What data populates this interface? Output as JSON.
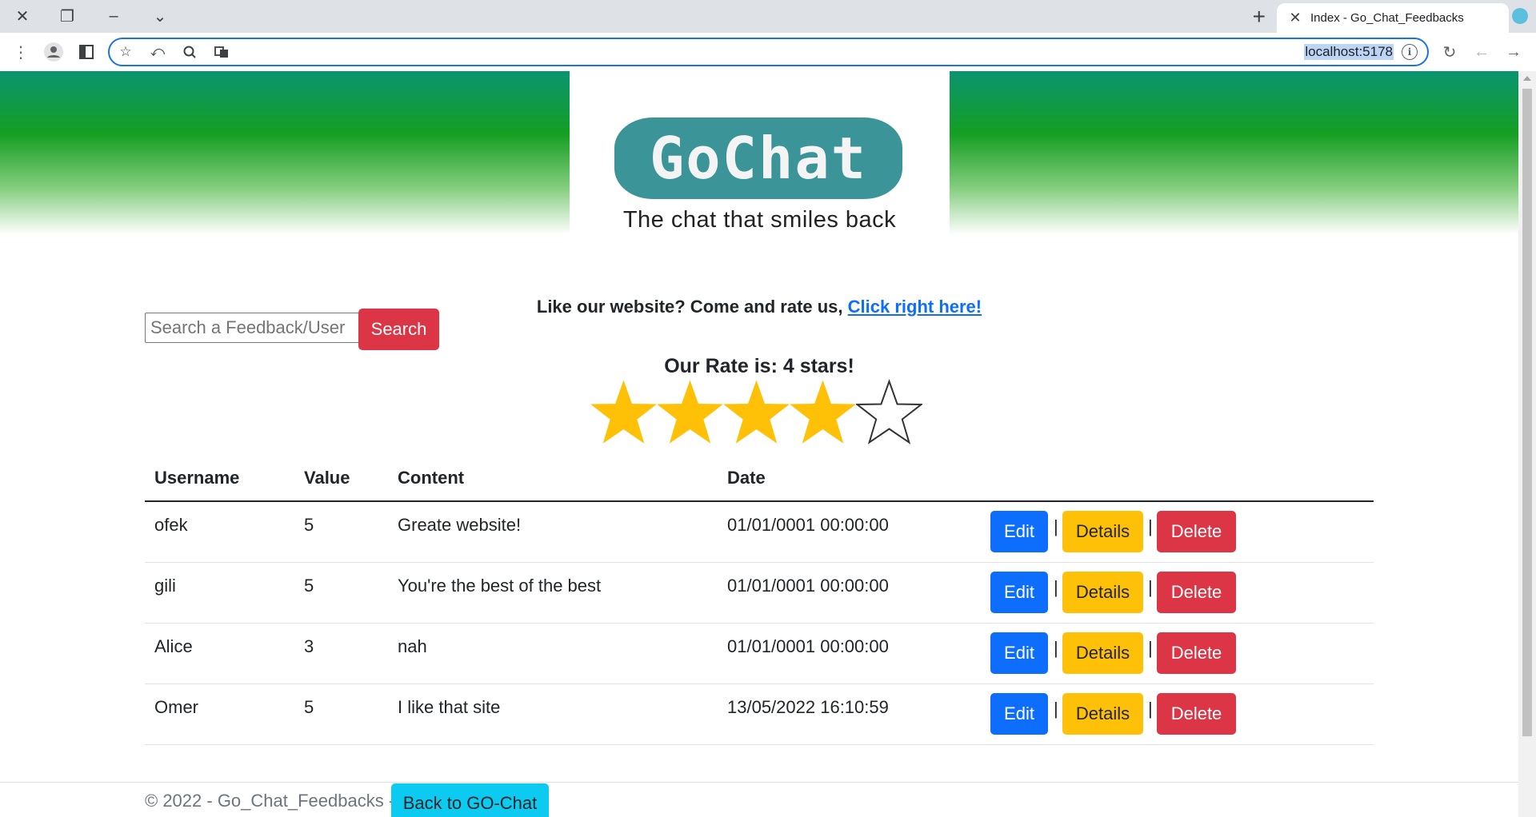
{
  "browser": {
    "tab_title": "Index - Go_Chat_Feedbacks",
    "url": "localhost:5178"
  },
  "header": {
    "logo_text": "GoChat",
    "tagline": "The chat that smiles back"
  },
  "search": {
    "placeholder": "Search a Feedback/User",
    "button_label": "Search"
  },
  "rate_prompt": {
    "text": "Like our website? Come and rate us, ",
    "link_label": "Click right here!"
  },
  "rating": {
    "title": "Our Rate is: 4 stars!",
    "value": 4,
    "max": 5,
    "star_color": "#ffc107"
  },
  "table": {
    "headers": [
      "Username",
      "Value",
      "Content",
      "Date"
    ],
    "rows": [
      {
        "username": "ofek",
        "value": "5",
        "content": "Greate website!",
        "date": "01/01/0001 00:00:00"
      },
      {
        "username": "gili",
        "value": "5",
        "content": "You're the best of the best",
        "date": "01/01/0001 00:00:00"
      },
      {
        "username": "Alice",
        "value": "3",
        "content": "nah",
        "date": "01/01/0001 00:00:00"
      },
      {
        "username": "Omer",
        "value": "5",
        "content": "I like that site",
        "date": "13/05/2022 16:10:59"
      }
    ],
    "actions": {
      "edit": "Edit",
      "details": "Details",
      "delete": "Delete",
      "separator": "|"
    }
  },
  "footer": {
    "text": "© 2022 - Go_Chat_Feedbacks -",
    "button_label": "Back to GO-Chat"
  },
  "colors": {
    "primary": "#0d6efd",
    "danger": "#dc3545",
    "warning": "#ffc107",
    "info": "#0dcaf0",
    "header_green": "#149e22",
    "logo_teal": "#3b9498"
  }
}
